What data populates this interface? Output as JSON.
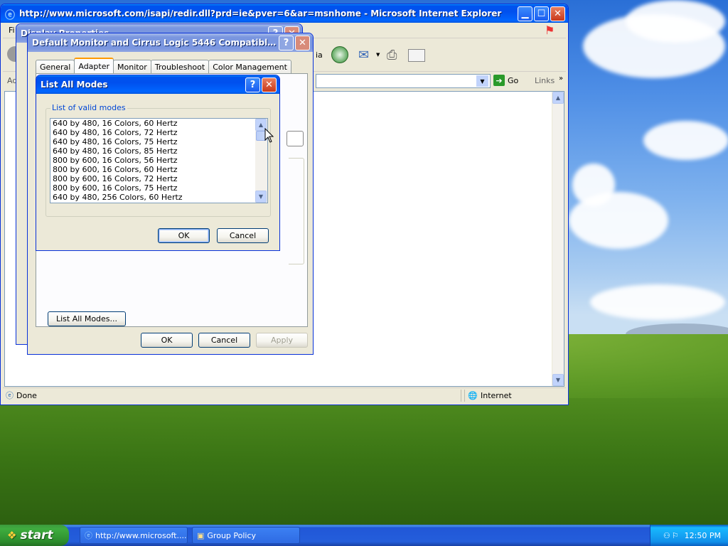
{
  "ie": {
    "title": "http://www.microsoft.com/isapi/redir.dll?prd=ie&pver=6&ar=msnhome - Microsoft Internet Explorer",
    "menu_first": "Fi",
    "addr_label": "Ad",
    "go_label": "Go",
    "links_label": "Links",
    "toolbar_text": "ia",
    "status_text": "Done",
    "zone_text": "Internet"
  },
  "display_properties": {
    "title": "Display Properties"
  },
  "monitor_dialog": {
    "title": "Default Monitor and Cirrus Logic 5446 Compatible Gr...",
    "tabs": [
      "General",
      "Adapter",
      "Monitor",
      "Troubleshoot",
      "Color Management"
    ],
    "active_tab": "Adapter",
    "list_all_modes_label": "List All Modes...",
    "ok_label": "OK",
    "cancel_label": "Cancel",
    "apply_label": "Apply"
  },
  "list_modes_dialog": {
    "title": "List All Modes",
    "group_label": "List of valid modes",
    "modes": [
      "640 by 480, 16 Colors, 60 Hertz",
      "640 by 480, 16 Colors, 72 Hertz",
      "640 by 480, 16 Colors, 75 Hertz",
      "640 by 480, 16 Colors, 85 Hertz",
      "800 by 600, 16 Colors, 56 Hertz",
      "800 by 600, 16 Colors, 60 Hertz",
      "800 by 600, 16 Colors, 72 Hertz",
      "800 by 600, 16 Colors, 75 Hertz",
      "640 by 480, 256 Colors, 60 Hertz"
    ],
    "ok_label": "OK",
    "cancel_label": "Cancel"
  },
  "taskbar": {
    "start_label": "start",
    "items": [
      "http://www.microsoft....",
      "Group Policy"
    ],
    "clock": "12:50 PM"
  },
  "colors": {
    "title_active": "#0054e3",
    "title_inactive": "#7a96df",
    "taskbar": "#245edb",
    "start_green": "#3c9a3c"
  }
}
